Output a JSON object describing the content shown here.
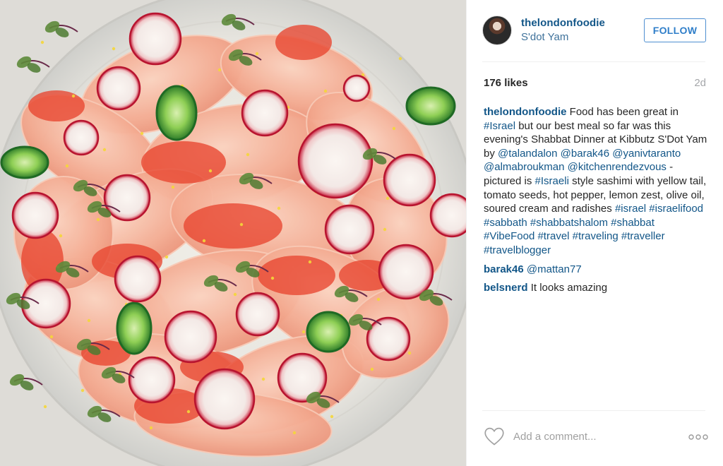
{
  "post": {
    "username": "thelondonfoodie",
    "location": "S'dot Yam",
    "follow_label": "FOLLOW",
    "likes": "176 likes",
    "time_ago": "2d"
  },
  "caption": {
    "user": "thelondonfoodie",
    "parts": [
      {
        "text": " Food has been great in ",
        "link": false
      },
      {
        "text": "#Israel",
        "link": true
      },
      {
        "text": " but our best meal so far was this evening's Shabbat Dinner at Kibbutz S'Dot Yam by ",
        "link": false
      },
      {
        "text": "@talandalon",
        "link": true
      },
      {
        "text": " ",
        "link": false
      },
      {
        "text": "@barak46",
        "link": true
      },
      {
        "text": " ",
        "link": false
      },
      {
        "text": "@yanivtaranto",
        "link": true
      },
      {
        "text": " ",
        "link": false
      },
      {
        "text": "@almabroukman",
        "link": true
      },
      {
        "text": " ",
        "link": false
      },
      {
        "text": "@kitchenrendezvous",
        "link": true
      },
      {
        "text": " - pictured is ",
        "link": false
      },
      {
        "text": "#Israeli",
        "link": true
      },
      {
        "text": " style sashimi with yellow tail, tomato seeds, hot pepper, lemon zest, olive oil, soured cream and radishes ",
        "link": false
      },
      {
        "text": "#israel",
        "link": true
      },
      {
        "text": " ",
        "link": false
      },
      {
        "text": "#israelifood",
        "link": true
      },
      {
        "text": " ",
        "link": false
      },
      {
        "text": "#sabbath",
        "link": true
      },
      {
        "text": " ",
        "link": false
      },
      {
        "text": "#shabbatshalom",
        "link": true
      },
      {
        "text": " ",
        "link": false
      },
      {
        "text": "#shabbat",
        "link": true
      },
      {
        "text": " ",
        "link": false
      },
      {
        "text": "#VibeFood",
        "link": true
      },
      {
        "text": " ",
        "link": false
      },
      {
        "text": "#travel",
        "link": true
      },
      {
        "text": " ",
        "link": false
      },
      {
        "text": "#traveling",
        "link": true
      },
      {
        "text": " ",
        "link": false
      },
      {
        "text": "#traveller",
        "link": true
      },
      {
        "text": " ",
        "link": false
      },
      {
        "text": "#travelblogger",
        "link": true
      }
    ]
  },
  "comments": [
    {
      "user": "barak46",
      "parts": [
        {
          "text": " ",
          "link": false
        },
        {
          "text": "@mattan77",
          "link": true
        }
      ]
    },
    {
      "user": "belsnerd",
      "parts": [
        {
          "text": " It looks amazing",
          "link": false
        }
      ]
    }
  ],
  "actions": {
    "comment_placeholder": "Add a comment...",
    "like_icon": "heart-outline-icon",
    "more_icon": "more-dots-icon"
  },
  "colors": {
    "username_blue": "#125688",
    "link_blue": "#125688",
    "follow_blue": "#2f7ec9",
    "muted_gray": "#a5a7aa"
  }
}
